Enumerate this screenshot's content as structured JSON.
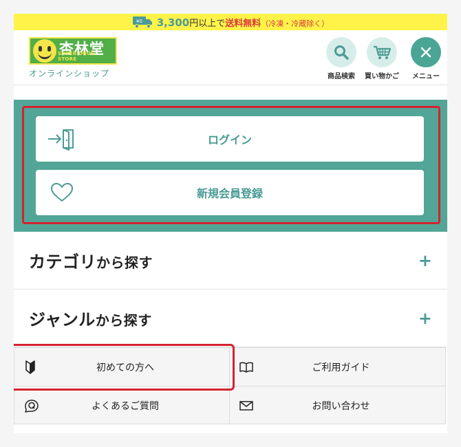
{
  "promo": {
    "yen_badge": "¥0",
    "amount": "3,300",
    "amount_suffix": "円以上で",
    "free_text": "送料無料",
    "note": "（冷凍・冷蔵除く）"
  },
  "header": {
    "logo_name": "杏林堂",
    "logo_sub": "SUPER DRUG STORE",
    "logo_caption": "オンラインショップ",
    "search_label": "商品検索",
    "cart_label": "買い物かご",
    "menu_label": "メニュー"
  },
  "account": {
    "login_label": "ログイン",
    "register_label": "新規会員登録"
  },
  "accordion": {
    "category_main": "カテゴリ",
    "category_rest": "から探す",
    "genre_main": "ジャンル",
    "genre_rest": "から探す",
    "expand_symbol": "+"
  },
  "links": [
    {
      "label": "初めての方へ",
      "icon": "beginner-mark-icon"
    },
    {
      "label": "ご利用ガイド",
      "icon": "book-icon"
    },
    {
      "label": "よくあるご質問",
      "icon": "faq-q-icon"
    },
    {
      "label": "お問い合わせ",
      "icon": "envelope-icon"
    }
  ],
  "colors": {
    "accent": "#52a597",
    "brand_green": "#52ae47",
    "brand_yellow": "#f4e64a",
    "promo_bg": "#fff34a",
    "highlight_red": "#d5222f"
  }
}
